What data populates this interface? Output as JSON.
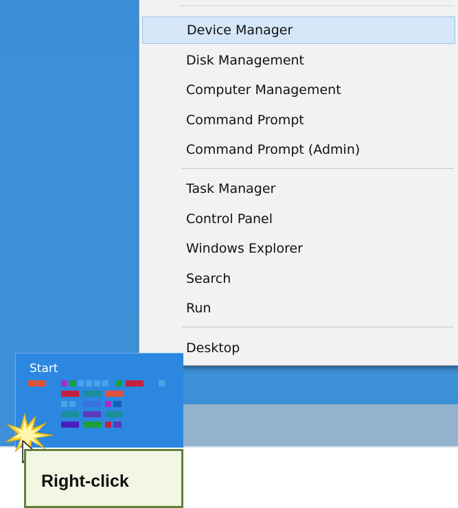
{
  "menu": {
    "items": [
      {
        "label": "Device Manager"
      },
      {
        "label": "Disk Management"
      },
      {
        "label": "Computer Management"
      },
      {
        "label": "Command Prompt"
      },
      {
        "label": "Command Prompt (Admin)"
      },
      {
        "label": "Task Manager"
      },
      {
        "label": "Control Panel"
      },
      {
        "label": "Windows Explorer"
      },
      {
        "label": "Search"
      },
      {
        "label": "Run"
      },
      {
        "label": "Desktop"
      }
    ]
  },
  "start": {
    "label": "Start"
  },
  "callout": {
    "text": "Right-click"
  },
  "colors": {
    "desktop": "#3b8fd9",
    "highlight": "#d5e6f7",
    "start_tile": "#2b87e0",
    "callout_border": "#5f7f3a"
  },
  "icons": [
    "start-tiles-icon",
    "pointer-cursor-icon",
    "click-burst-icon"
  ]
}
